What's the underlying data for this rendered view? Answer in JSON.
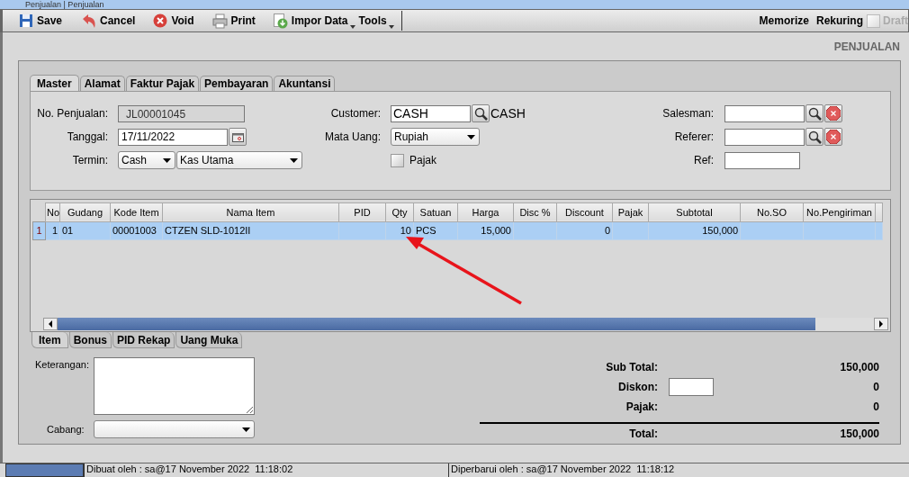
{
  "window": {
    "title": "Penjualan | Penjualan"
  },
  "toolbar": {
    "buttons": [
      {
        "label": "Save",
        "kind": "save"
      },
      {
        "label": "Cancel",
        "kind": "undo"
      },
      {
        "label": "Void",
        "kind": "void"
      },
      {
        "label": "Print",
        "kind": "print"
      },
      {
        "label": "Impor Data",
        "kind": "import",
        "menu": true
      },
      {
        "label": "Tools",
        "kind": "plain",
        "menu": true
      }
    ],
    "right": [
      {
        "label": "Memorize"
      },
      {
        "label": "Rekuring"
      }
    ],
    "draft": {
      "label": "Draft",
      "checked": false,
      "disabled": true
    }
  },
  "heading": "PENJUALAN",
  "tabs": [
    {
      "label": "Master",
      "selected": true
    },
    {
      "label": "Alamat",
      "selected": false
    },
    {
      "label": "Faktur Pajak",
      "selected": false
    },
    {
      "label": "Pembayaran",
      "selected": false
    },
    {
      "label": "Akuntansi",
      "selected": false
    }
  ],
  "master": {
    "no_penjualan": {
      "label": "No. Penjualan:",
      "value": "JL00001045"
    },
    "tanggal": {
      "label": "Tanggal:",
      "value": "17/11/2022"
    },
    "termin": {
      "label": "Termin:",
      "value": "Cash",
      "account": "Kas Utama"
    },
    "customer": {
      "label": "Customer:",
      "value": "CASH",
      "name": "CASH"
    },
    "mata_uang": {
      "label": "Mata Uang:",
      "value": "Rupiah"
    },
    "pajak": {
      "label": "Pajak",
      "checked": false
    },
    "salesman": {
      "label": "Salesman:"
    },
    "referer": {
      "label": "Referer:"
    },
    "ref": {
      "label": "Ref:"
    }
  },
  "table": {
    "columns": [
      {
        "label": "No"
      },
      {
        "label": "Gudang"
      },
      {
        "label": "Kode Item"
      },
      {
        "label": "Nama Item"
      },
      {
        "label": "PID"
      },
      {
        "label": "Qty"
      },
      {
        "label": "Satuan"
      },
      {
        "label": "Harga"
      },
      {
        "label": "Disc %"
      },
      {
        "label": "Discount"
      },
      {
        "label": "Pajak"
      },
      {
        "label": "Subtotal"
      },
      {
        "label": "No.SO"
      },
      {
        "label": "No.Pengiriman"
      }
    ],
    "rows": [
      {
        "header": "1",
        "selected": true,
        "cells": [
          "1",
          "01",
          "00001003",
          "CTZEN SLD-1012II",
          null,
          "10",
          "PCS",
          "15,000",
          null,
          "0",
          null,
          "150,000",
          null,
          null
        ]
      }
    ]
  },
  "bottom_tabs": [
    {
      "label": "Item",
      "selected": true
    },
    {
      "label": "Bonus",
      "selected": false
    },
    {
      "label": "PID Rekap",
      "selected": false
    },
    {
      "label": "Uang Muka",
      "selected": false
    }
  ],
  "keterangan": {
    "label": "Keterangan:"
  },
  "cabang": {
    "label": "Cabang:"
  },
  "totals": [
    {
      "kind": "value",
      "label": "Sub Total:",
      "value": "150,000"
    },
    {
      "kind": "input",
      "label": "Diskon:",
      "value": "0"
    },
    {
      "kind": "value",
      "label": "Pajak:",
      "value": "0"
    },
    {
      "kind": "total",
      "label": "Total:",
      "value": "150,000"
    }
  ],
  "status_bar": [
    "Dibuat oleh : sa@17 November 2022  11:18:02",
    "Diperbarui oleh : sa@17 November 2022  11:18:12"
  ]
}
